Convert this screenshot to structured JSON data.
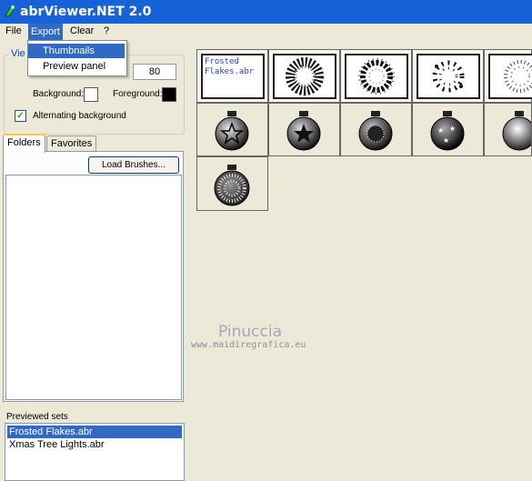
{
  "window": {
    "title": "abrViewer.NET 2.0"
  },
  "menu": [
    {
      "label": "File"
    },
    {
      "label": "Export"
    },
    {
      "label": "Clear"
    },
    {
      "label": "?"
    }
  ],
  "export_menu": {
    "items": [
      "Thumbnails",
      "Preview panel"
    ],
    "highlighted": "Thumbnails"
  },
  "view_options": {
    "legend_partial": "Vie",
    "size_value": "80",
    "background_label": "Background:",
    "foreground_label": "Foreground:",
    "background_color": "#ffffff",
    "foreground_color": "#000000",
    "alternating_label": "Alternating background",
    "alternating_checked": true
  },
  "tabs": {
    "folders": "Folders",
    "favorites": "Favorites",
    "active": "Folders"
  },
  "load_button": "Load Brushes...",
  "previewed": {
    "label": "Previewed sets",
    "items": [
      "Frosted Flakes.abr",
      "Xmas Tree Lights.abr"
    ],
    "selected": "Frosted Flakes.abr"
  },
  "thumbnails": {
    "set_name": "Frosted Flakes.abr",
    "row1": [
      "set-name",
      "flake-wreath-dense",
      "flake-wreath-ring",
      "flake-wreath-scatter",
      "flake-wreath-sparse"
    ],
    "row2": [
      "ornament-star-outline",
      "ornament-star-solid",
      "ornament-flake",
      "ornament-stars",
      "ornament-plain"
    ],
    "row3": [
      "ornament-speckled"
    ]
  },
  "watermark": {
    "line1": "Pinuccia",
    "line2": "www.maidiregrafica.eu"
  }
}
